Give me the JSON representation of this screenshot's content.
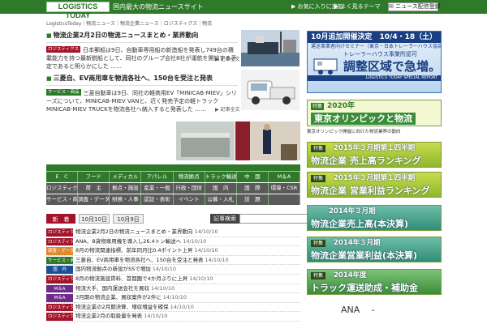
{
  "header": {
    "logo": "LOGISTICS TODAY",
    "tagline": "国内最大の物流ニュースサイト",
    "nav_favorite": "お気に入りに追加",
    "nav_themes": "よく見るテーマ",
    "register_button": "ニュース配信登録"
  },
  "breadcrumb": "LogisticsToday｜物流ニュース｜物流企業ニュース｜ロジスティクス｜物流",
  "articles": [
    {
      "title": "物流企業2月2日の物流ニュースまとめ・業界動向",
      "category": "ロジスティクス",
      "body": "日本郵船は9日、自動車専用船の新造船を発表し749台の積載能力を持つ最新鋭船として、同社のグループ会社8社が運航を開始する予定であると明らかにした ……",
      "more": "記事全文"
    },
    {
      "title": "三菱自、EV商用車を物流各社へ、150台を受注と発表",
      "category": "サービス・商品",
      "body": "三菱自動車は9日、同社の軽商用EV「MINICAB-MIEV」シリーズについて、MINICAB-MIEV VANと、近く発売予定の軽トラックMINICAB-MIEV TRUCKを物流各社へ納入すると発表した ……",
      "more": "記事全文"
    }
  ],
  "category_grid": {
    "row1": [
      "E　C",
      "フード",
      "メディカル",
      "アパレル",
      "物流拠点",
      "トラック輸送",
      "中　国",
      "M＆A"
    ],
    "row2": [
      "ロジスティクス",
      "荷　主",
      "拠点・施設",
      "産業・一般",
      "行政・団体",
      "国　内",
      "国　際",
      "環境・CSR"
    ],
    "row3": [
      "サービス・商品",
      "調査・データ",
      "財務・人事",
      "認証・表彰",
      "イベント",
      "公募・入札",
      "話　題",
      ""
    ]
  },
  "tabs": {
    "tab1": "新　着",
    "tab2": "10月10日",
    "tab3": "10月9日",
    "search_label": "記事検索",
    "search_placeholder": "",
    "search_button": "検索"
  },
  "news_list": [
    {
      "label": "ロジスティクス",
      "color": "red",
      "title": "物流企業2月2日の物流ニュースまとめ・業界動向",
      "date": "14/10/10"
    },
    {
      "label": "ロジスティクス",
      "color": "red",
      "title": "ANA、B貨物専用機を導入し26.4トン輸送へ",
      "date": "14/10/10"
    },
    {
      "label": "調査・データ",
      "color": "orange",
      "title": "8月の物流関連指標、前年同月比0.4ポイント上昇",
      "date": "14/10/10"
    },
    {
      "label": "サービス・商品",
      "color": "green",
      "title": "三菱自、EV商用車を物流各社へ、150台を受注と発表",
      "date": "14/10/10"
    },
    {
      "label": "国　内",
      "color": "blue",
      "title": "国内物流拠点の新設がSSで増加",
      "date": "14/10/10"
    },
    {
      "label": "ロジスティクス",
      "color": "red",
      "title": "8月の物流施設賃料、首都圏で4か月ぶりに上昇",
      "date": "14/10/10"
    },
    {
      "label": "M＆A",
      "color": "purple",
      "title": "物流大手、国内運送会社を買収",
      "date": "14/10/10"
    },
    {
      "label": "M＆A",
      "color": "purple",
      "title": "3月期の物流企業、買収案件が2件に",
      "date": "14/10/10"
    },
    {
      "label": "ロジスティクス",
      "color": "red",
      "title": "物流企業の2月期決算、増収増益を確保",
      "date": "14/10/10"
    },
    {
      "label": "ロジスティクス",
      "color": "red",
      "title": "物流企業2月の取扱量を発表",
      "date": "14/10/10"
    }
  ],
  "sidebar": {
    "banner1": {
      "headline": "10月追加開催決定　10/4・18（土）",
      "sub": "運送事業者向けセミナー（東京・日本トレーラーハウス協会）",
      "mid": "トレーラーハウス事業所認可",
      "big": "調整区域で急増。",
      "foot": "LOGISTICS TODAY SPECIAL REPORT"
    },
    "banner2": {
      "tag": "特集",
      "year": "2020年",
      "title": "東京オリンピックと物流",
      "caption": "東京オリンピック開催に向けた物流業界の動向"
    },
    "green_banners": [
      {
        "tag": "特集",
        "line1": "2015年３月期第１四半期",
        "line2": "物流企業 売上高ランキング",
        "style": "lime"
      },
      {
        "tag": "特集",
        "line1": "2015年３月期第１四半期",
        "line2": "物流企業 営業利益ランキング",
        "style": "lime"
      },
      {
        "tag": "",
        "line1": "2014年３月期",
        "line2": "物流企業売上高(本決算)",
        "style": "teal"
      },
      {
        "tag": "特集",
        "line1": "2014年３月期",
        "line2": "物流企業営業利益(本決算)",
        "style": "teal"
      },
      {
        "tag": "特集",
        "line1": "2014年度",
        "line2": "トラック運送助成・補助金",
        "style": "green"
      }
    ],
    "ana_text": "ANA　 -"
  }
}
